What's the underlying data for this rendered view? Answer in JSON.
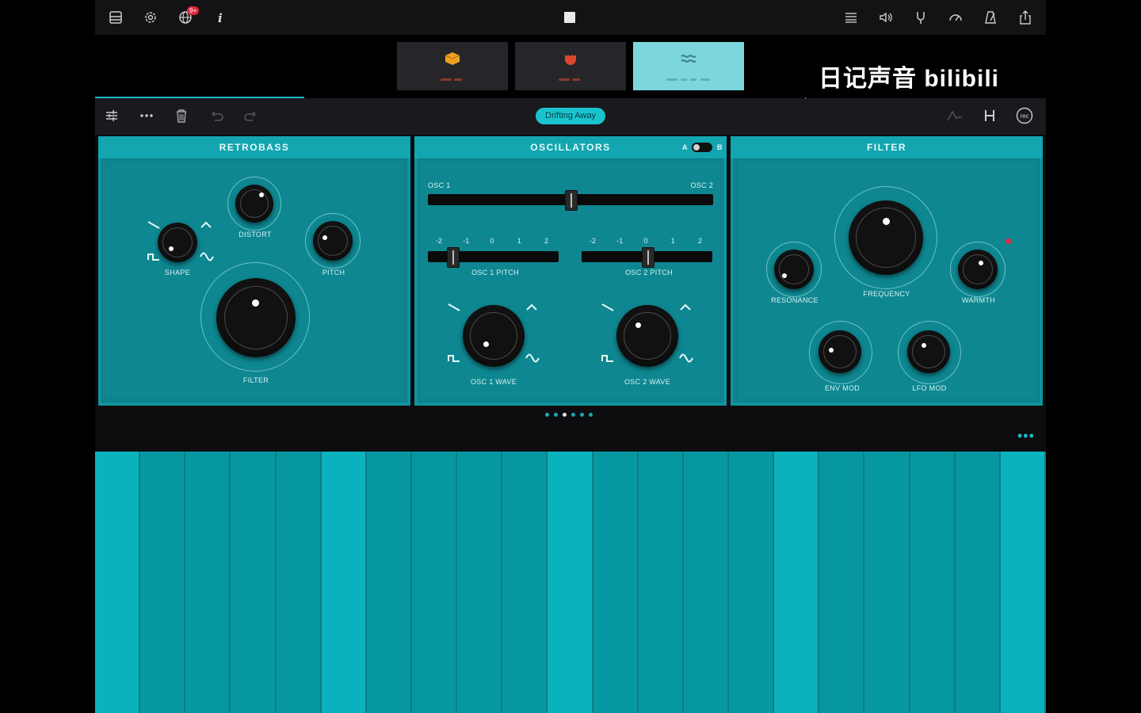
{
  "topbar": {
    "icons": [
      "stack-icon",
      "gear-icon",
      "globe-icon",
      "info-icon",
      "list-icon",
      "speaker-icon",
      "tuning-fork-icon",
      "gauge-icon",
      "metronome-icon",
      "share-icon"
    ],
    "badge": "9+",
    "stop_icon": "stop-icon"
  },
  "tracks": [
    {
      "icon": "box-icon",
      "color": "#f0a020",
      "active": false
    },
    {
      "icon": "fire-icon",
      "color": "#e0462b",
      "active": false
    },
    {
      "icon": "wave-icon",
      "color": "#9ad6db",
      "active": true
    }
  ],
  "watermark": "日记声音 bilibili",
  "add_track": "+",
  "toolbar": {
    "icons_left": [
      "sliders-icon",
      "more-icon",
      "trash-icon",
      "undo-icon",
      "redo-icon"
    ],
    "preset": "Drifting Away",
    "icons_right": [
      "envelope-icon",
      "bracket-icon",
      "rec-icon"
    ],
    "rec_label": "rec"
  },
  "panels": {
    "retrobass": {
      "title": "RETROBASS",
      "shape_label": "SHAPE",
      "distort_label": "DISTORT",
      "pitch_label": "PITCH",
      "filter_label": "FILTER"
    },
    "oscillators": {
      "title": "OSCILLATORS",
      "a": "A",
      "b": "B",
      "osc1": "OSC 1",
      "osc2": "OSC 2",
      "ticks": [
        "-2",
        "-1",
        "0",
        "1",
        "2"
      ],
      "osc1_pitch": "OSC 1 PITCH",
      "osc2_pitch": "OSC 2 PITCH",
      "osc1_wave": "OSC 1 WAVE",
      "osc2_wave": "OSC 2 WAVE",
      "osc_mix": 0.5,
      "osc1_pitch_value": -1.5,
      "osc2_pitch_value": 0
    },
    "filter": {
      "title": "FILTER",
      "resonance_label": "RESONANCE",
      "frequency_label": "FREQUENCY",
      "warmth_label": "WARMTH",
      "env_mod_label": "ENV MOD",
      "lfo_mod_label": "LFO MOD"
    }
  },
  "pager": {
    "pages": 6,
    "active": 2
  },
  "keyboard": {
    "white_keys": 21
  }
}
